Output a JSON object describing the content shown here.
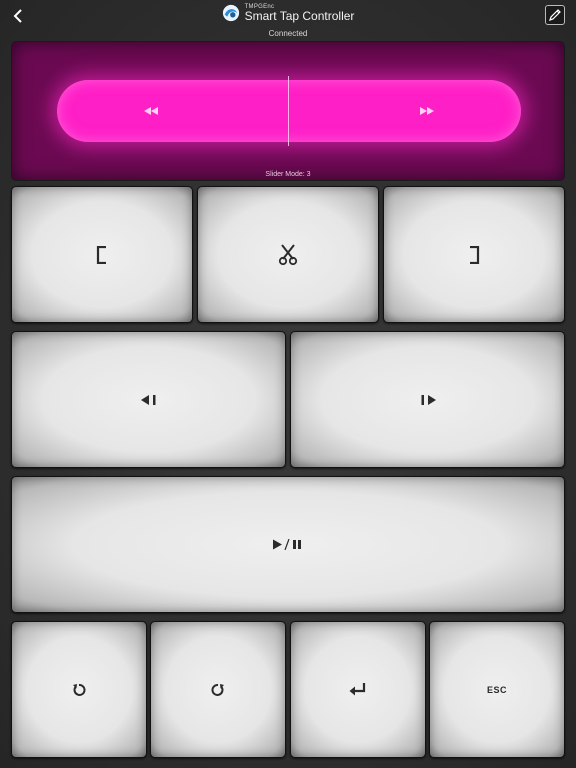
{
  "header": {
    "brand": "TMPGEnc",
    "title": "Smart Tap Controller",
    "status": "Connected"
  },
  "slider": {
    "mode_label": "Slider Mode: 3",
    "left_icon": "rewind-icon",
    "right_icon": "fast-forward-icon"
  },
  "keys": {
    "row1": [
      "mark-in-icon",
      "scissors-icon",
      "mark-out-icon"
    ],
    "row2": [
      "step-back-frame-icon",
      "step-forward-frame-icon"
    ],
    "row3": [
      "play-pause-icon"
    ],
    "row4": [
      "undo-icon",
      "redo-icon",
      "enter-icon",
      "ESC"
    ]
  },
  "colors": {
    "slider_panel": "#6b0a52",
    "slider_bar": "#ff1fc7",
    "background": "#2e2e2e",
    "key_face": "#e8e8e8"
  }
}
